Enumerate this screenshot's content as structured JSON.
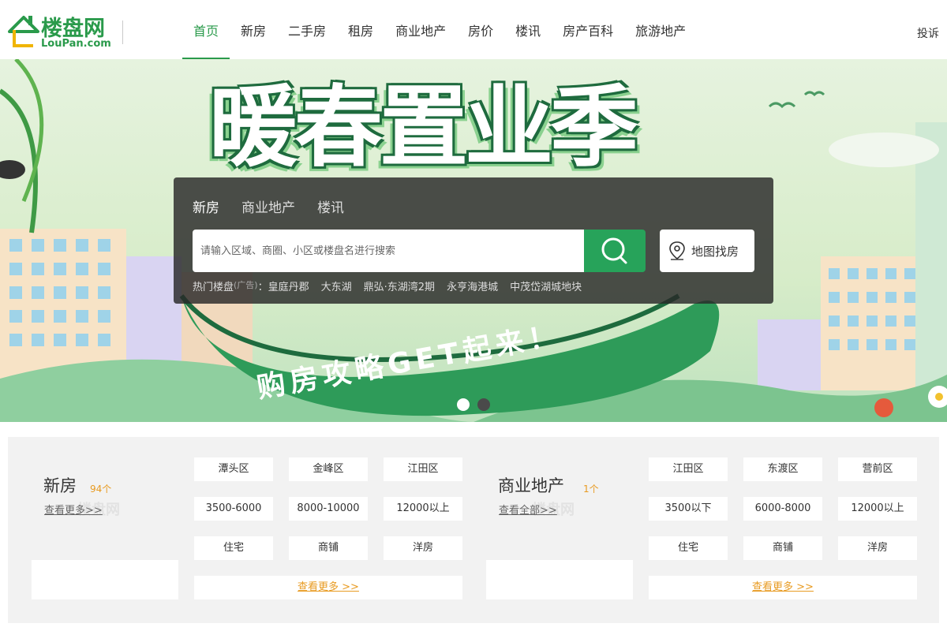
{
  "header": {
    "logo_cn": "楼盘网",
    "logo_en": "LouPan.com",
    "nav": [
      "首页",
      "新房",
      "二手房",
      "租房",
      "商业地产",
      "房价",
      "楼讯",
      "房产百科",
      "旅游地产"
    ],
    "complain": "投诉"
  },
  "banner": {
    "slogan": "暖春置业季",
    "ribbon": "购房攻略GET起来！"
  },
  "search": {
    "tabs": [
      "新房",
      "商业地产",
      "楼讯"
    ],
    "placeholder": "请输入区域、商圈、小区或楼盘名进行搜索",
    "map_label": "地图找房",
    "hot_label": "热门楼盘",
    "hot_ad": "(广告)",
    "hot_colon": "：",
    "hot_items": [
      "皇庭丹郡",
      "大东湖",
      "鼎弘·东湖湾2期",
      "永亨海港城",
      "中茂岱湖城地块"
    ]
  },
  "new_house": {
    "title": "新房",
    "count": "94个",
    "more": "查看更多>>",
    "watermark": "楼盘网",
    "tags": [
      "潭头区",
      "金峰区",
      "江田区",
      "3500-6000",
      "8000-10000",
      "12000以上",
      "住宅",
      "商铺",
      "洋房"
    ],
    "more_bar": "查看更多 >>"
  },
  "commercial": {
    "title": "商业地产",
    "count": "1个",
    "more": "查看全部>>",
    "watermark": "楼盘网",
    "tags": [
      "江田区",
      "东渡区",
      "营前区",
      "3500以下",
      "6000-8000",
      "12000以上",
      "住宅",
      "商铺",
      "洋房"
    ],
    "more_bar": "查看更多 >>"
  },
  "colors": {
    "brand": "#2a9a4b",
    "search_button": "#27a35a",
    "accent": "#e89b22"
  }
}
